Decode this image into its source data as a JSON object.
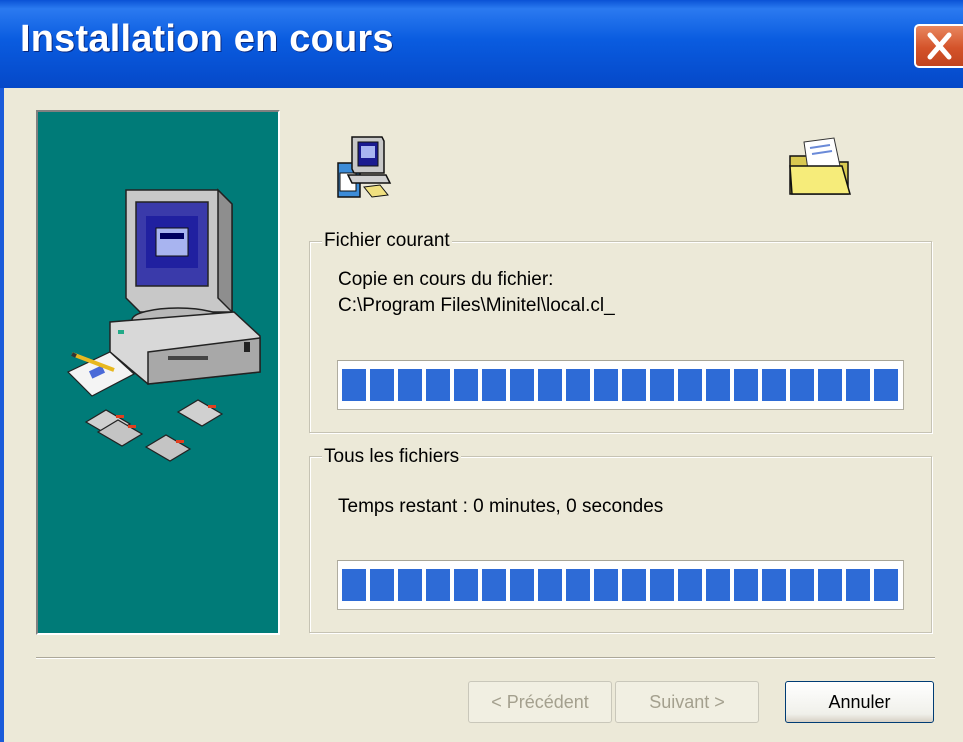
{
  "window": {
    "title": "Installation en cours"
  },
  "icons": {
    "close": "close-icon",
    "side_illustration": "computer-with-floppy-disks-illustration",
    "source": "computer-setup-icon",
    "destination": "open-folder-icon"
  },
  "current_file": {
    "group_label": "Fichier courant",
    "action_text": "Copie en cours du fichier:",
    "file_path": "C:\\Program Files\\Minitel\\local.cl_",
    "progress": 1.0
  },
  "all_files": {
    "group_label": "Tous les fichiers",
    "time_remaining": "Temps restant : 0 minutes, 0 secondes",
    "progress": 1.0
  },
  "buttons": {
    "back": "< Précédent",
    "next": "Suivant >",
    "cancel": "Annuler"
  },
  "colors": {
    "titlebar": "#0A5CE0",
    "side_panel": "#007B78",
    "progress_fill": "#2E6BD6",
    "close_button": "#D4532A"
  }
}
